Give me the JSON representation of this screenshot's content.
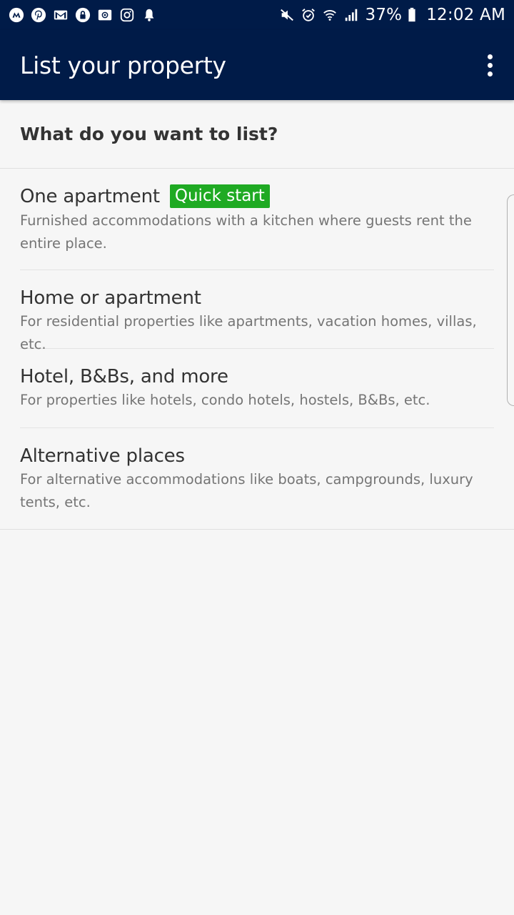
{
  "status_bar": {
    "left_icons": [
      "messenger-icon",
      "pinterest-icon",
      "gmail-icon",
      "vpn-lock-icon",
      "email-icon",
      "instagram-icon",
      "notification-bell-icon"
    ],
    "right_icons": [
      "mute-icon",
      "alarm-icon",
      "wifi-icon",
      "signal-icon",
      "battery-icon"
    ],
    "battery": "37%",
    "time": "12:02 AM"
  },
  "app_bar": {
    "title": "List your property",
    "menu_icon": "overflow-menu-icon"
  },
  "question": "What do you want to list?",
  "options": [
    {
      "title": "One apartment",
      "badge": "Quick start",
      "description": "Furnished accommodations with a kitchen where guests rent the entire place."
    },
    {
      "title": "Home or apartment",
      "description": "For residential properties like apartments, vacation homes, villas, etc."
    },
    {
      "title": "Hotel, B&Bs, and more",
      "description": "For properties like hotels, condo hotels, hostels, B&Bs, etc."
    },
    {
      "title": "Alternative places",
      "description": "For alternative accommodations like boats, campgrounds, luxury tents, etc."
    }
  ],
  "colors": {
    "app_bar": "#001b48",
    "badge": "#1faa23",
    "background": "#f6f6f6",
    "title_text": "#333333",
    "description_text": "#757575"
  }
}
